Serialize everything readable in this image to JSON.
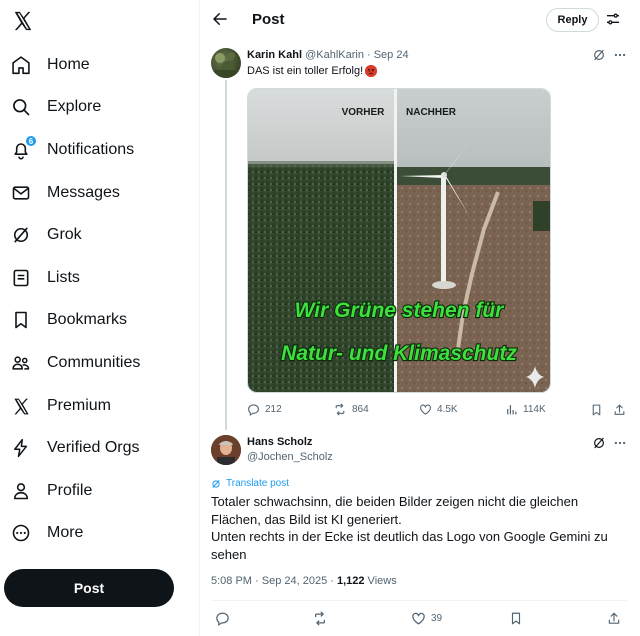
{
  "sidebar": {
    "items": [
      {
        "label": "Home",
        "icon": "home-icon"
      },
      {
        "label": "Explore",
        "icon": "search-icon"
      },
      {
        "label": "Notifications",
        "icon": "bell-icon",
        "badge": "6"
      },
      {
        "label": "Messages",
        "icon": "envelope-icon"
      },
      {
        "label": "Grok",
        "icon": "grok-icon"
      },
      {
        "label": "Lists",
        "icon": "list-icon"
      },
      {
        "label": "Bookmarks",
        "icon": "bookmark-icon"
      },
      {
        "label": "Communities",
        "icon": "people-icon"
      },
      {
        "label": "Premium",
        "icon": "x-logo-icon"
      },
      {
        "label": "Verified Orgs",
        "icon": "lightning-icon"
      },
      {
        "label": "Profile",
        "icon": "person-icon"
      },
      {
        "label": "More",
        "icon": "more-circle-icon"
      }
    ],
    "post_label": "Post"
  },
  "header": {
    "title": "Post",
    "reply_label": "Reply"
  },
  "tweet1": {
    "name": "Karin Kahl",
    "handle_date": "@KahlKarin · Sep 24",
    "text": "DAS ist ein toller Erfolg!",
    "media": {
      "label_left": "VORHER",
      "label_right": "NACHHER",
      "caption_line1": "Wir Grüne stehen für",
      "caption_line2": "Natur- und Klimaschutz"
    },
    "stats": {
      "replies": "212",
      "reposts": "864",
      "likes": "4.5K",
      "views": "114K"
    }
  },
  "tweet2": {
    "name": "Hans Scholz",
    "handle": "@Jochen_Scholz",
    "translate": "Translate post",
    "body_line1": "Totaler schwachsinn, die beiden Bilder zeigen nicht die gleichen Flächen, das Bild ist KI generiert.",
    "body_line2": "Unten rechts in der Ecke ist deutlich das Logo von Google Gemini zu sehen",
    "meta_time": "5:08 PM · Sep 24, 2025 · ",
    "meta_views_count": "1,122",
    "meta_views_label": " Views",
    "likes": "39"
  },
  "colors": {
    "accent": "#1d9bf0",
    "text": "#0f1419",
    "muted": "#536471",
    "caption_green": "#3de03d"
  }
}
